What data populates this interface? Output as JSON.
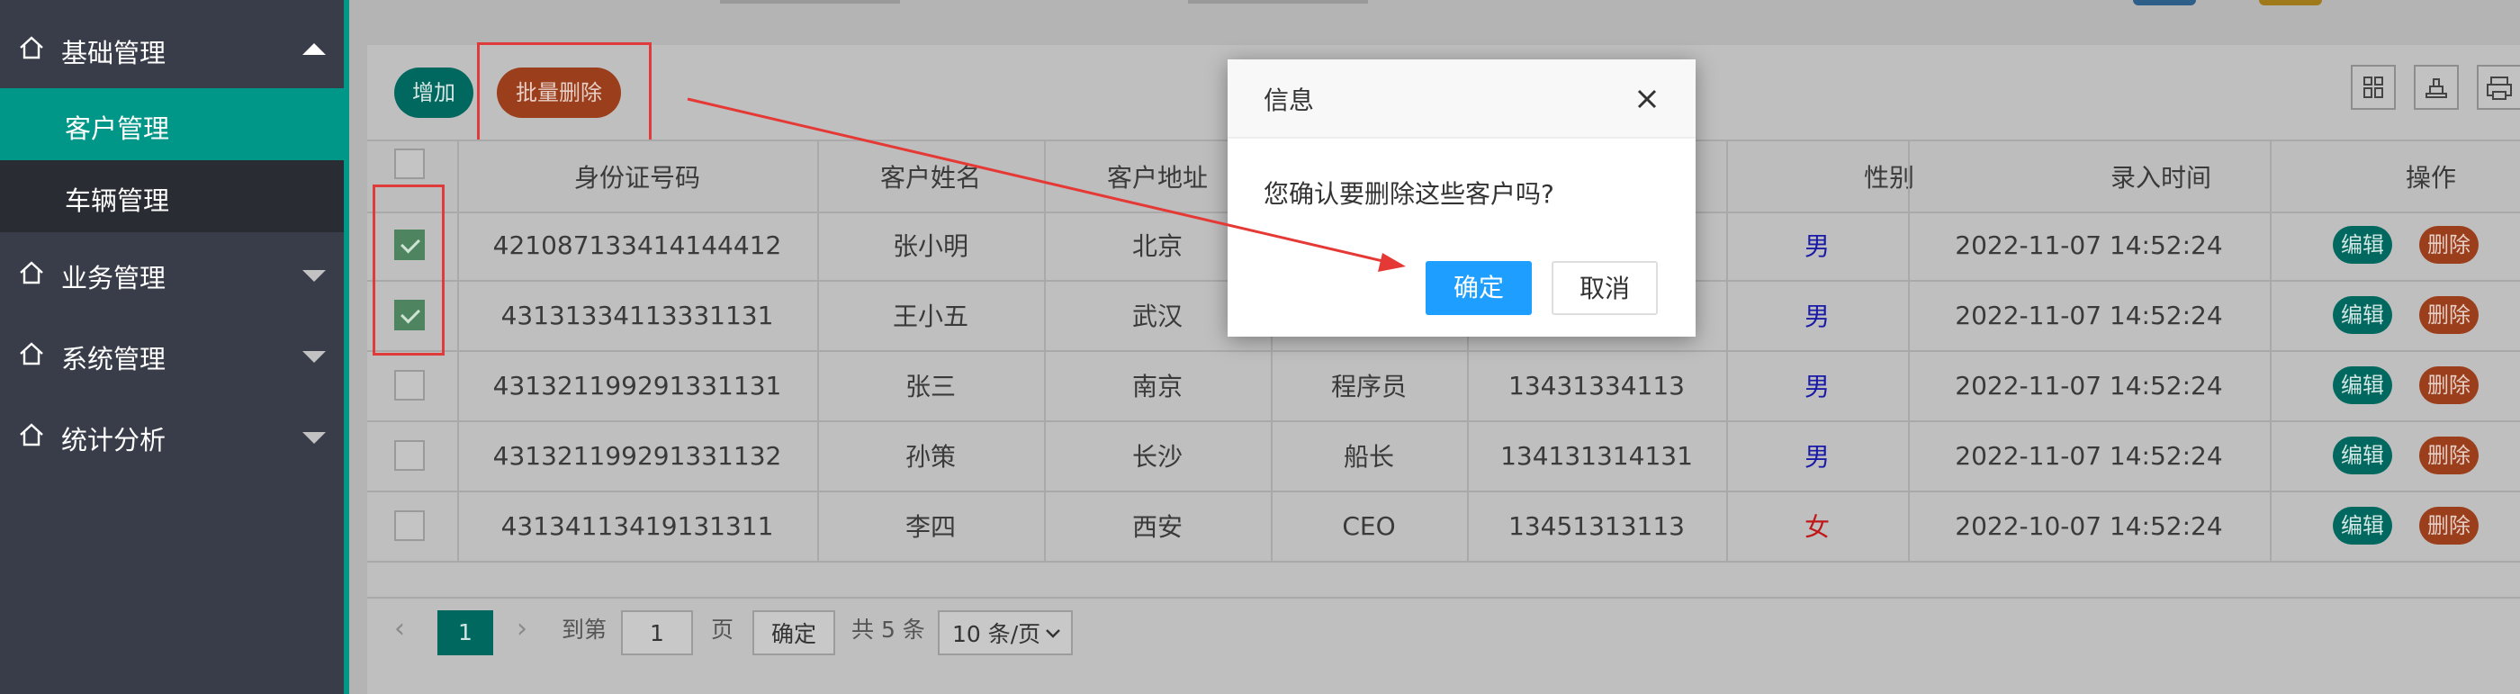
{
  "sidebar": {
    "items": [
      {
        "label": "基础管理",
        "expanded": true
      },
      {
        "label": "业务管理",
        "expanded": false
      },
      {
        "label": "系统管理",
        "expanded": false
      },
      {
        "label": "统计分析",
        "expanded": false
      }
    ],
    "sub_items": [
      {
        "label": "客户管理",
        "active": true
      },
      {
        "label": "车辆管理",
        "active": false
      }
    ]
  },
  "toolbar": {
    "add_label": "增加",
    "batch_delete_label": "批量删除"
  },
  "table": {
    "columns": [
      "身份证号码",
      "客户姓名",
      "客户地址",
      "",
      "",
      "性别",
      "录入时间",
      "操作"
    ],
    "rows": [
      {
        "checked": true,
        "id": "421087133414144412",
        "name": "张小明",
        "address": "北京",
        "job": "",
        "phone": "",
        "gender": "男",
        "time": "2022-11-07 14:52:24"
      },
      {
        "checked": true,
        "id": "43131334113331131",
        "name": "王小五",
        "address": "武汉",
        "job": "",
        "phone": "",
        "gender": "男",
        "time": "2022-11-07 14:52:24"
      },
      {
        "checked": false,
        "id": "431321199291331131",
        "name": "张三",
        "address": "南京",
        "job": "程序员",
        "phone": "13431334113",
        "gender": "男",
        "time": "2022-11-07 14:52:24"
      },
      {
        "checked": false,
        "id": "431321199291331132",
        "name": "孙策",
        "address": "长沙",
        "job": "船长",
        "phone": "134131314131",
        "gender": "男",
        "time": "2022-11-07 14:52:24"
      },
      {
        "checked": false,
        "id": "43134113419131311",
        "name": "李四",
        "address": "西安",
        "job": "CEO",
        "phone": "13451313113",
        "gender": "女",
        "time": "2022-10-07 14:52:24"
      }
    ],
    "edit_label": "编辑",
    "delete_label": "删除"
  },
  "pagination": {
    "prev": "‹",
    "current_page": "1",
    "next": "›",
    "goto_label": "到第",
    "page_input": "1",
    "page_unit": "页",
    "confirm_label": "确定",
    "total_label": "共 5 条",
    "page_size": "10 条/页"
  },
  "modal": {
    "title": "信息",
    "message": "您确认要删除这些客户吗?",
    "ok_label": "确定",
    "cancel_label": "取消"
  },
  "colors": {
    "sidebar_bg": "#393d49",
    "accent": "#009688",
    "danger": "#ff5722",
    "primary": "#1e9fff",
    "annotation": "#e03b3b"
  }
}
